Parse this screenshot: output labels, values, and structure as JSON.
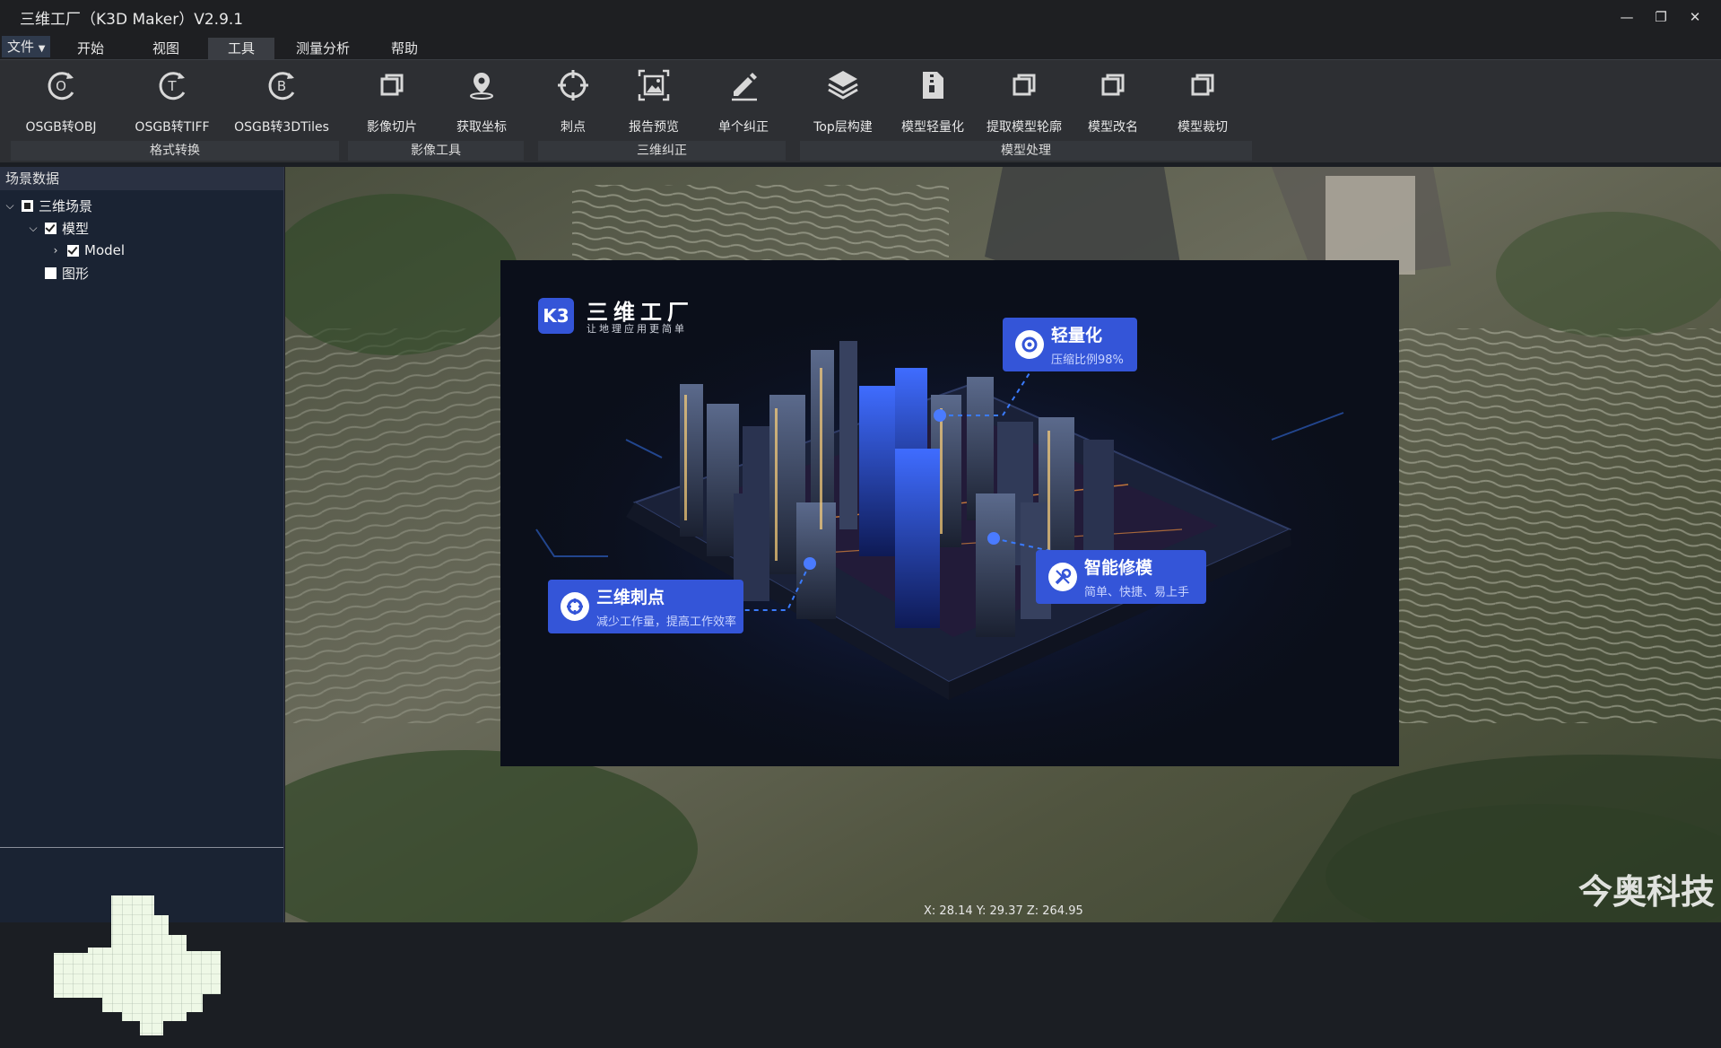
{
  "window": {
    "title": "三维工厂（K3D Maker）V2.9.1",
    "minimize": "—",
    "restore": "❐",
    "close": "✕"
  },
  "menu": {
    "file": "文件",
    "items": [
      "开始",
      "视图",
      "工具",
      "测量分析",
      "帮助"
    ],
    "active": "工具"
  },
  "ribbon": {
    "buttons": [
      {
        "label": "OSGB转OBJ",
        "icon": "osgb-obj-icon"
      },
      {
        "label": "OSGB转TIFF",
        "icon": "osgb-tiff-icon"
      },
      {
        "label": "OSGB转3DTiles",
        "icon": "osgb-3dtiles-icon"
      },
      {
        "label": "影像切片",
        "icon": "image-slice-icon"
      },
      {
        "label": "获取坐标",
        "icon": "location-pin-icon"
      },
      {
        "label": "刺点",
        "icon": "crosshair-icon"
      },
      {
        "label": "报告预览",
        "icon": "report-image-icon"
      },
      {
        "label": "单个纠正",
        "icon": "pen-edit-icon"
      },
      {
        "label": "Top层构建",
        "icon": "layers-icon"
      },
      {
        "label": "模型轻量化",
        "icon": "file-compress-icon"
      },
      {
        "label": "提取模型轮廓",
        "icon": "copy-icon"
      },
      {
        "label": "模型改名",
        "icon": "copy-icon"
      },
      {
        "label": "模型裁切",
        "icon": "copy-icon"
      }
    ],
    "groups": [
      "格式转换",
      "影像工具",
      "三维纠正",
      "模型处理"
    ]
  },
  "panel": {
    "title": "场景数据",
    "tree": {
      "root": "三维场景",
      "model": "模型",
      "model_child": "Model",
      "graphics": "图形"
    }
  },
  "splash": {
    "brand": "三维工厂",
    "slogan": "让地理应用更简单",
    "badges": [
      {
        "title": "轻量化",
        "subtitle": "压缩比例98%"
      },
      {
        "title": "三维刺点",
        "subtitle": "减少工作量，提高工作效率"
      },
      {
        "title": "智能修模",
        "subtitle": "简单、快捷、易上手"
      }
    ]
  },
  "status": {
    "coords": "X: 28.14 Y: 29.37  Z: 264.95"
  },
  "watermark": "今奥科技",
  "colors": {
    "accent": "#3455d8",
    "panel": "#1a2333",
    "ribbon": "#2d2f33"
  }
}
